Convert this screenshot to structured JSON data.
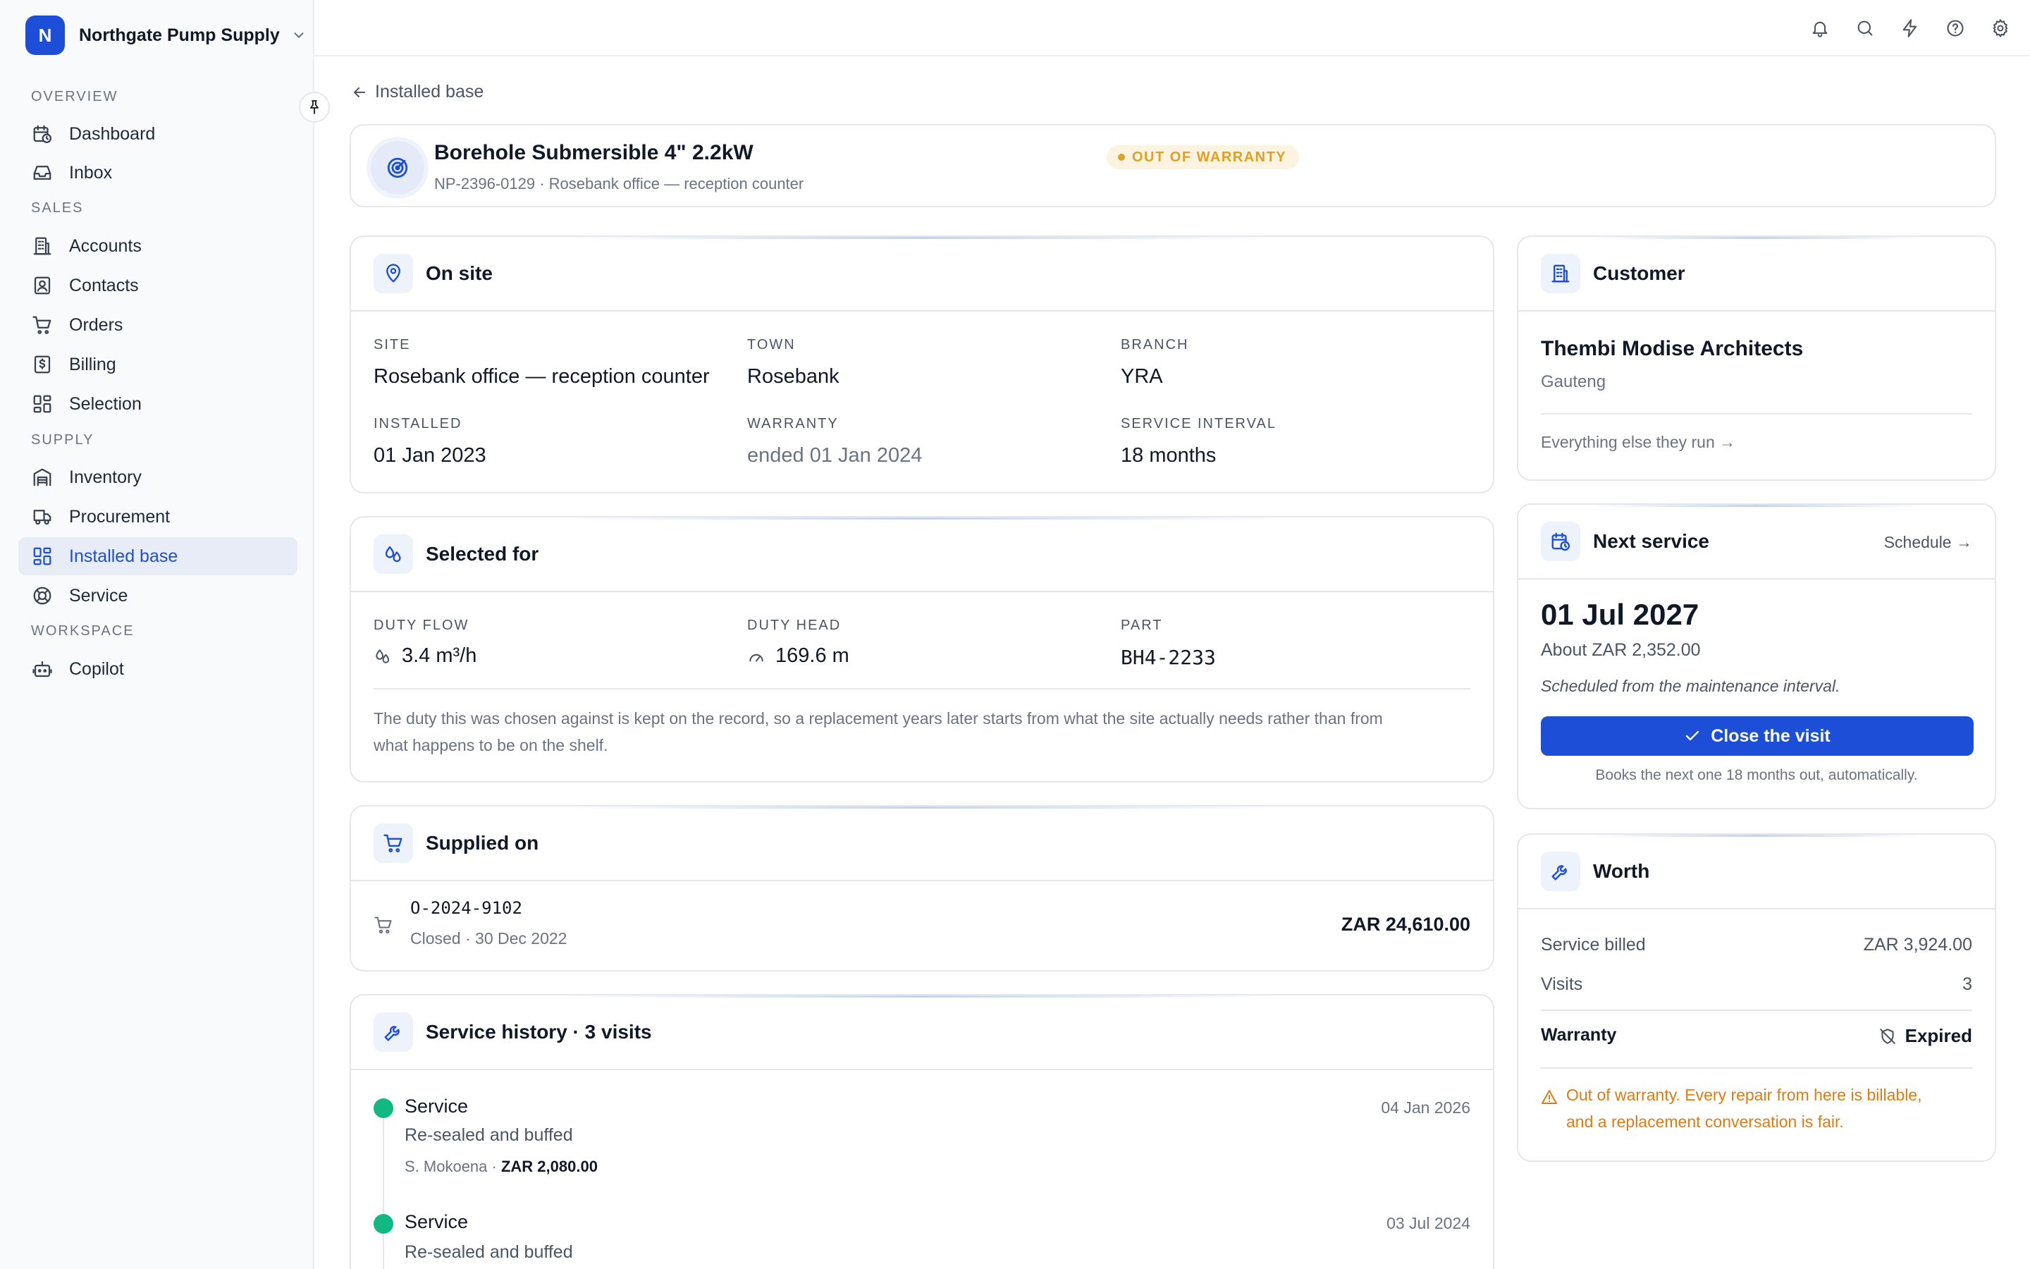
{
  "org": {
    "initial": "N",
    "name": "Northgate Pump Supply"
  },
  "nav": {
    "sections": {
      "overview": "OVERVIEW",
      "sales": "SALES",
      "supply": "SUPPLY",
      "workspace": "WORKSPACE"
    },
    "items": {
      "dashboard": "Dashboard",
      "inbox": "Inbox",
      "accounts": "Accounts",
      "contacts": "Contacts",
      "orders": "Orders",
      "billing": "Billing",
      "selection": "Selection",
      "inventory": "Inventory",
      "procurement": "Procurement",
      "installed_base": "Installed base",
      "service": "Service",
      "copilot": "Copilot"
    },
    "active": "installed_base"
  },
  "breadcrumb": {
    "back_label": "Installed base"
  },
  "asset": {
    "title": "Borehole Submersible 4\" 2.2kW",
    "badge": "OUT OF WARRANTY",
    "subtitle": "NP-2396-0129 · Rosebank office — reception counter"
  },
  "on_site": {
    "title": "On site",
    "site_label": "SITE",
    "site": "Rosebank office — reception counter",
    "town_label": "TOWN",
    "town": "Rosebank",
    "branch_label": "BRANCH",
    "branch": "YRA",
    "installed_label": "INSTALLED",
    "installed": "01 Jan 2023",
    "warranty_label": "WARRANTY",
    "warranty": "ended 01 Jan 2024",
    "interval_label": "SERVICE INTERVAL",
    "interval": "18 months"
  },
  "selected_for": {
    "title": "Selected for",
    "flow_label": "DUTY FLOW",
    "flow": "3.4 m³/h",
    "head_label": "DUTY HEAD",
    "head": "169.6 m",
    "part_label": "PART",
    "part": "BH4-2233",
    "note_line1": "The duty this was chosen against is kept on the record, so a replacement years later starts from what the site actually needs rather than from",
    "note_line2": "what happens to be on the shelf."
  },
  "supplied_on": {
    "title": "Supplied on",
    "order": "O-2024-9102",
    "status": "Closed · 30 Dec 2022",
    "amount": "ZAR 24,610.00"
  },
  "history": {
    "title": "Service history · 3 visits",
    "visits": [
      {
        "type": "Service",
        "date": "04 Jan 2026",
        "desc": "Re-sealed and buffed",
        "tech": "S. Mokoena ·",
        "amount": "ZAR 2,080.00"
      },
      {
        "type": "Service",
        "date": "03 Jul 2024",
        "desc": "Re-sealed and buffed"
      }
    ]
  },
  "customer": {
    "title": "Customer",
    "name": "Thembi Modise Architects",
    "region": "Gauteng",
    "link": "Everything else they run →"
  },
  "next_service": {
    "title": "Next service",
    "schedule_link": "Schedule →",
    "date": "01 Jul 2027",
    "estimate": "About ZAR 2,352.00",
    "note": "Scheduled from the maintenance interval.",
    "button": "Close the visit",
    "footnote": "Books the next one 18 months out, automatically."
  },
  "worth": {
    "title": "Worth",
    "billed_label": "Service billed",
    "billed": "ZAR 3,924.00",
    "visits_label": "Visits",
    "visits": "3",
    "warranty_label": "Warranty",
    "warranty": "Expired",
    "warning_line1": "Out of warranty. Every repair from here is billable,",
    "warning_line2": "and a replacement conversation is fair."
  },
  "colors": {
    "accent": "#1d4ed8",
    "warning": "#e0a021",
    "success": "#10b981"
  }
}
